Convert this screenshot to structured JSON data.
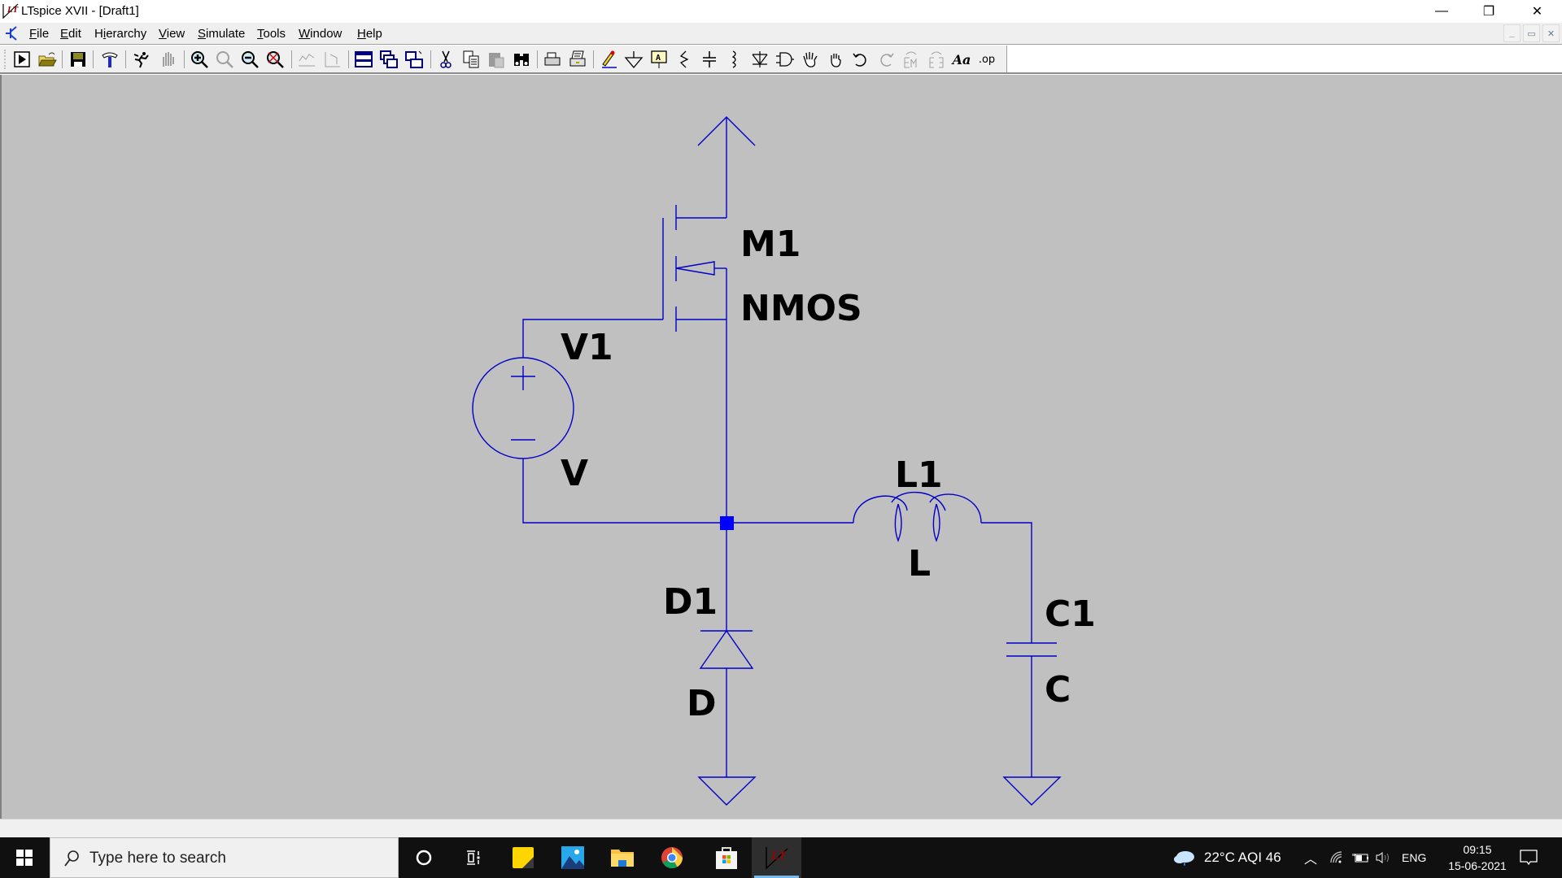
{
  "window": {
    "title": "LTspice XVII - [Draft1]",
    "controls": {
      "minimize": "—",
      "maximize": "❐",
      "close": "✕"
    },
    "mdi_controls": {
      "minimize": "_",
      "restore": "🗗",
      "close": "✕"
    }
  },
  "menubar": {
    "items": [
      {
        "label": "File",
        "accel": "F",
        "rest": "ile"
      },
      {
        "label": "Edit",
        "accel": "E",
        "rest": "dit"
      },
      {
        "label": "Hierarchy",
        "accel": "H",
        "pre": "H",
        "acc2": "i",
        "rest": "erarchy"
      },
      {
        "label": "View",
        "accel": "V",
        "rest": "iew"
      },
      {
        "label": "Simulate",
        "accel": "S",
        "rest": "imulate"
      },
      {
        "label": "Tools",
        "accel": "T",
        "rest": "ools"
      },
      {
        "label": "Window",
        "accel": "W",
        "rest": "indow"
      },
      {
        "label": "Help",
        "accel": "H",
        "rest": "elp"
      }
    ]
  },
  "toolbar": {
    "buttons": [
      "run-icon",
      "open-icon",
      "save-icon",
      "control-panel-icon",
      "halt-icon",
      "pan-icon",
      "zoom-in-icon",
      "zoom-area-icon",
      "zoom-out-icon",
      "zoom-fit-icon",
      "autoscale-icon",
      "probe-icon",
      "tile-horizontal-icon",
      "cascade-icon",
      "tile-vertical-icon",
      "cut-icon",
      "copy-icon",
      "paste-icon",
      "find-icon",
      "print-preview-icon",
      "print-icon",
      "wire-icon",
      "ground-icon",
      "label-net-icon",
      "resistor-icon",
      "capacitor-icon",
      "inductor-icon",
      "diode-icon",
      "component-icon",
      "move-icon",
      "drag-icon",
      "undo-icon",
      "redo-icon",
      "rotate-icon",
      "mirror-icon",
      "text-icon",
      "spice-directive-icon"
    ],
    "text_icon_label": "Aa",
    "spice_directive_label": ".op"
  },
  "schematic": {
    "wire_color": "#0000c8",
    "junction_color": "#0000ff",
    "components": [
      {
        "ref": "M1",
        "value": "NMOS",
        "type": "nmos"
      },
      {
        "ref": "V1",
        "value": "V",
        "type": "voltage-source"
      },
      {
        "ref": "L1",
        "value": "L",
        "type": "inductor"
      },
      {
        "ref": "D1",
        "value": "D",
        "type": "diode"
      },
      {
        "ref": "C1",
        "value": "C",
        "type": "capacitor"
      }
    ]
  },
  "taskbar": {
    "search_placeholder": "Type here to search",
    "apps": [
      "cortana",
      "task-view",
      "sticky-notes",
      "photos",
      "file-explorer",
      "chrome",
      "microsoft-store",
      "ltspice"
    ],
    "weather": "22°C  AQI 46",
    "language": "ENG",
    "time": "09:15",
    "date": "15-06-2021"
  }
}
